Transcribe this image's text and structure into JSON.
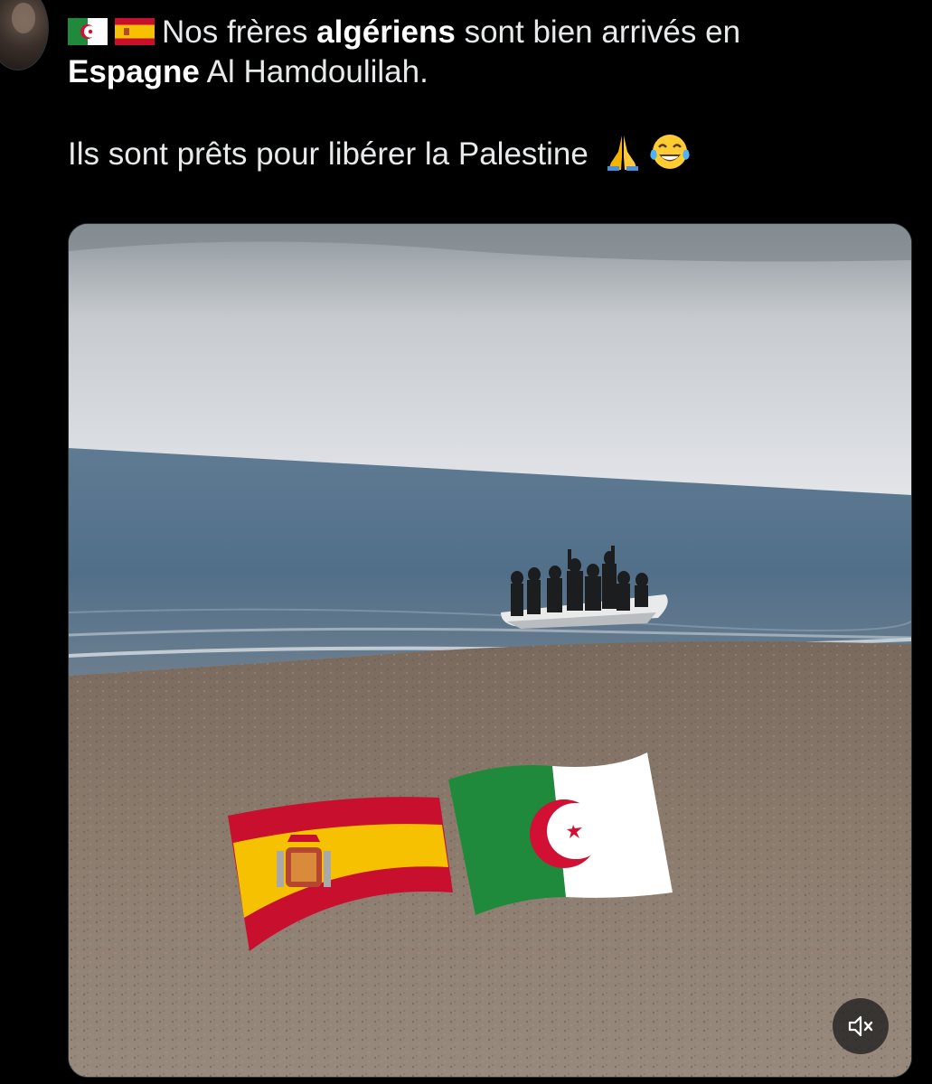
{
  "tweet": {
    "flags": [
      "algeria-flag-icon",
      "spain-flag-icon"
    ],
    "line1_pre": "Nos frères ",
    "line1_bold": "algériens",
    "line1_post": " sont bien arrivés en",
    "line2_bold": "Espagne",
    "line2_post": " Al Hamdoulilah.",
    "line3": "Ils sont prêts pour libérer la Palestine",
    "end_emojis": [
      "folded-hands-icon",
      "tears-of-joy-icon"
    ]
  },
  "media": {
    "type": "video",
    "overlay_emojis": [
      "spain-flag-emoji",
      "algeria-flag-emoji"
    ],
    "mute_icon": "speaker-muted-icon"
  },
  "colors": {
    "background": "#000000",
    "text": "#e7e9ea",
    "algeria_green": "#1f8a3b",
    "spain_red": "#c8102e",
    "spain_yellow": "#f6c100"
  }
}
